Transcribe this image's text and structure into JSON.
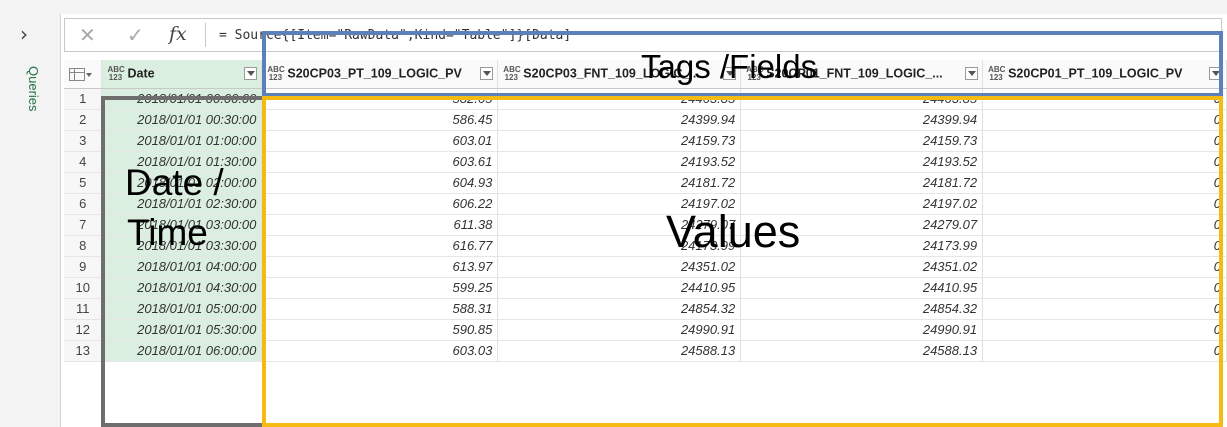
{
  "sidebar": {
    "toggle_icon": "chevron-right-icon",
    "label": "Queries"
  },
  "formula_bar": {
    "cancel_icon": "close-icon",
    "accept_icon": "check-icon",
    "fx_label": "fx",
    "formula": "= Source{[Item=\"RawData\",Kind=\"Table\"]}[Data]"
  },
  "grid": {
    "type_badge": {
      "top": "ABC",
      "bottom": "123"
    },
    "columns": [
      {
        "name": "Date"
      },
      {
        "name": "S20CP03_PT_109_LOGIC_PV"
      },
      {
        "name": "S20CP03_FNT_109_LOGIC_..."
      },
      {
        "name": "S20CP01_FNT_109_LOGIC_..."
      },
      {
        "name": "S20CP01_PT_109_LOGIC_PV"
      }
    ],
    "rows": [
      {
        "n": "1",
        "date": "2018/01/01 00:00:00",
        "v1": "582.65",
        "v2": "24463.85",
        "v3": "24463.85",
        "v4": "0"
      },
      {
        "n": "2",
        "date": "2018/01/01 00:30:00",
        "v1": "586.45",
        "v2": "24399.94",
        "v3": "24399.94",
        "v4": "0"
      },
      {
        "n": "3",
        "date": "2018/01/01 01:00:00",
        "v1": "603.01",
        "v2": "24159.73",
        "v3": "24159.73",
        "v4": "0"
      },
      {
        "n": "4",
        "date": "2018/01/01 01:30:00",
        "v1": "603.61",
        "v2": "24193.52",
        "v3": "24193.52",
        "v4": "0"
      },
      {
        "n": "5",
        "date": "2018/01/01 02:00:00",
        "v1": "604.93",
        "v2": "24181.72",
        "v3": "24181.72",
        "v4": "0"
      },
      {
        "n": "6",
        "date": "2018/01/01 02:30:00",
        "v1": "606.22",
        "v2": "24197.02",
        "v3": "24197.02",
        "v4": "0"
      },
      {
        "n": "7",
        "date": "2018/01/01 03:00:00",
        "v1": "611.38",
        "v2": "24279.07",
        "v3": "24279.07",
        "v4": "0"
      },
      {
        "n": "8",
        "date": "2018/01/01 03:30:00",
        "v1": "616.77",
        "v2": "24173.99",
        "v3": "24173.99",
        "v4": "0"
      },
      {
        "n": "9",
        "date": "2018/01/01 04:00:00",
        "v1": "613.97",
        "v2": "24351.02",
        "v3": "24351.02",
        "v4": "0"
      },
      {
        "n": "10",
        "date": "2018/01/01 04:30:00",
        "v1": "599.25",
        "v2": "24410.95",
        "v3": "24410.95",
        "v4": "0"
      },
      {
        "n": "11",
        "date": "2018/01/01 05:00:00",
        "v1": "588.31",
        "v2": "24854.32",
        "v3": "24854.32",
        "v4": "0"
      },
      {
        "n": "12",
        "date": "2018/01/01 05:30:00",
        "v1": "590.85",
        "v2": "24990.91",
        "v3": "24990.91",
        "v4": "0"
      },
      {
        "n": "13",
        "date": "2018/01/01 06:00:00",
        "v1": "603.03",
        "v2": "24588.13",
        "v3": "24588.13",
        "v4": "0"
      }
    ]
  },
  "annotations": {
    "tags_label": "Tags /Fields",
    "date_label_1": "Date /",
    "date_label_2": "Time",
    "values_label": "Values",
    "colors": {
      "tags": "#5b80ba",
      "date": "#6e6e6e",
      "values": "#f5bb12"
    }
  }
}
